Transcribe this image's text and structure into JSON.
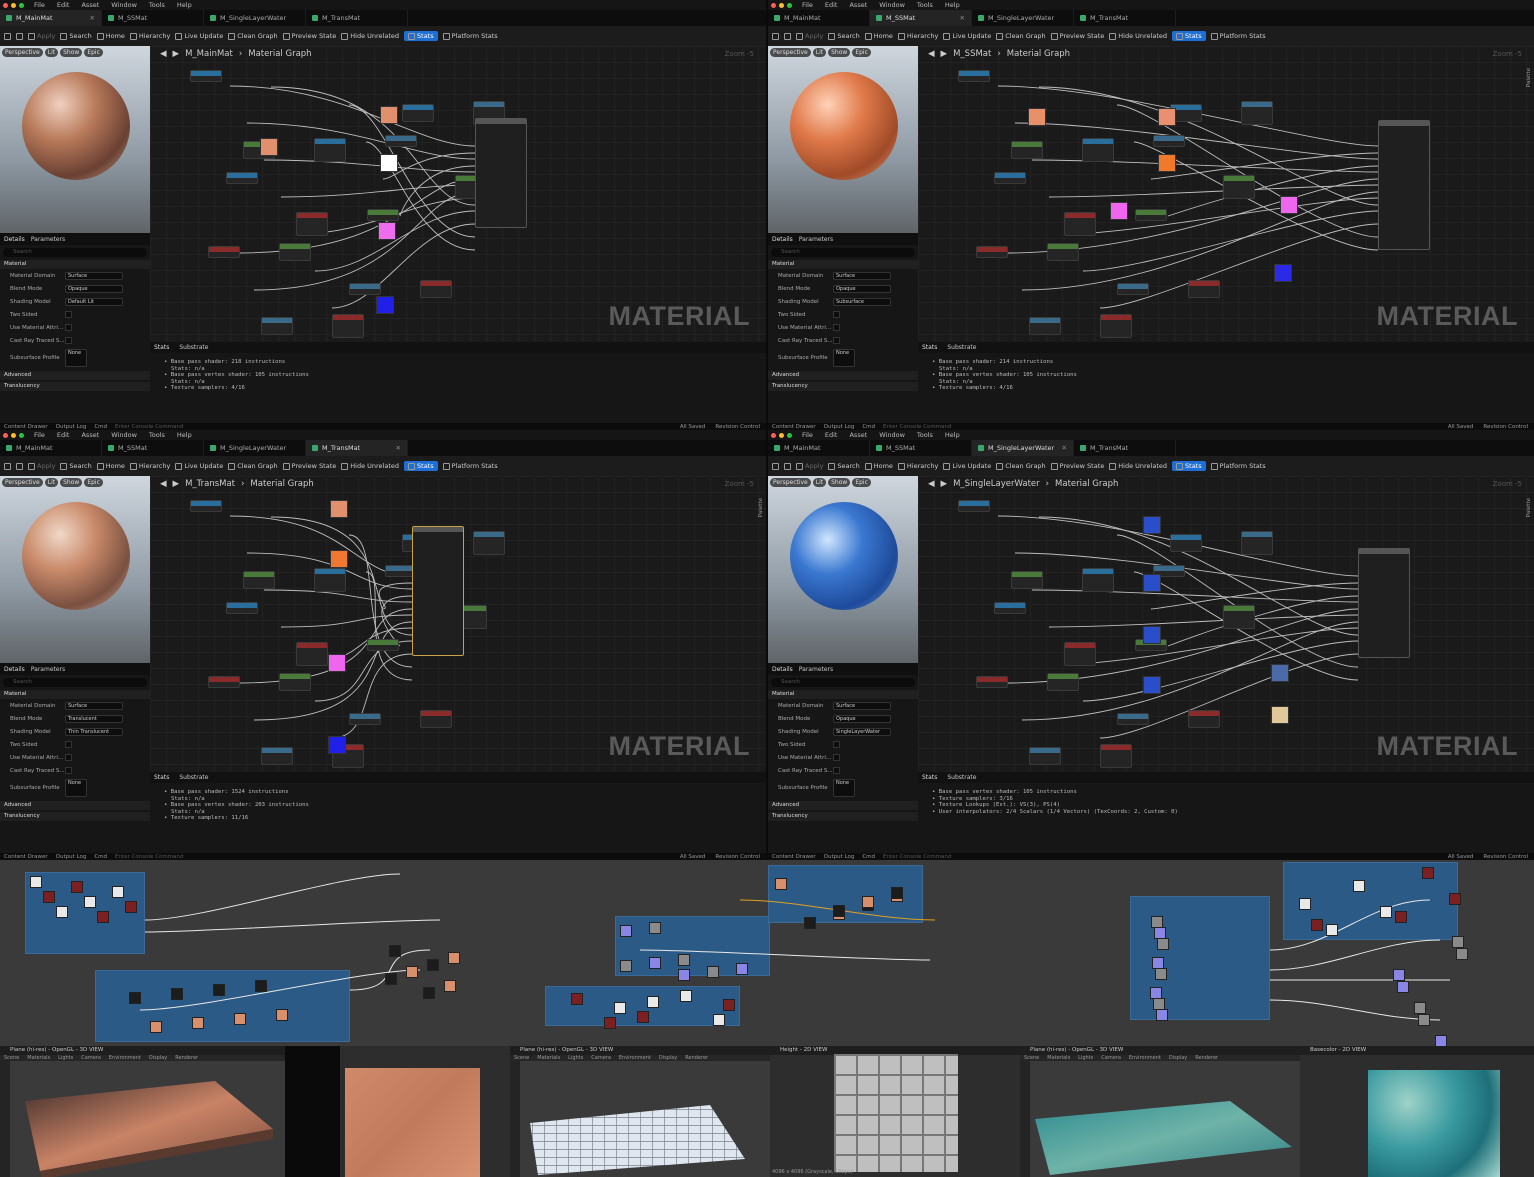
{
  "menu": [
    "File",
    "Edit",
    "Asset",
    "Window",
    "Tools",
    "Help"
  ],
  "tab_names": [
    "M_MainMat",
    "M_SSMat",
    "M_SingleLayerWater",
    "M_TransMat"
  ],
  "toolbar": {
    "apply": "Apply",
    "search": "Search",
    "home": "Home",
    "hierarchy": "Hierarchy",
    "live_update": "Live Update",
    "clean_graph": "Clean Graph",
    "preview_state": "Preview State",
    "hide_unrelated": "Hide Unrelated",
    "stats": "Stats",
    "platform_stats": "Platform Stats"
  },
  "viewport": {
    "perspective": "Perspective",
    "lit": "Lit",
    "show": "Show",
    "epic": "Epic"
  },
  "details": {
    "tab": "Details",
    "params": "Parameters",
    "search": "Search",
    "section": "Material",
    "domain_label": "Material Domain",
    "blend_label": "Blend Mode",
    "shading_label": "Shading Model",
    "two_sided": "Two Sided",
    "use_attr": "Use Material Attri...",
    "cast_ray": "Cast Ray Traced S...",
    "subsurface": "Subsurface Profile",
    "none": "None",
    "advanced": "Advanced",
    "translucency": "Translucency"
  },
  "graph": {
    "label": "Material Graph",
    "zoom": "Zoom -5",
    "watermark": "MATERIAL",
    "palette": "Palette"
  },
  "stats_tabs": {
    "stats": "Stats",
    "substrate": "Substrate"
  },
  "statusbar": {
    "content_drawer": "Content Drawer",
    "output_log": "Output Log",
    "cmd": "Cmd",
    "console": "Enter Console Command",
    "all_saved": "All Saved",
    "revision": "Revision Control"
  },
  "quads": [
    {
      "active_tab": 0,
      "title": "M_MainMat",
      "domain": "Surface",
      "blend": "Opaque",
      "shading": "Default Lit",
      "stats": [
        "Base pass shader: 218 instructions",
        "Stats: n/a",
        "Base pass vertex shader: 105 instructions",
        "Stats: n/a",
        "Texture samplers: 4/16"
      ]
    },
    {
      "active_tab": 1,
      "title": "M_SSMat",
      "domain": "Surface",
      "blend": "Opaque",
      "shading": "Subsurface",
      "stats": [
        "Base pass shader: 214 instructions",
        "Stats: n/a",
        "Base pass vertex shader: 105 instructions",
        "Stats: n/a",
        "Texture samplers: 4/16"
      ]
    },
    {
      "active_tab": 3,
      "title": "M_TransMat",
      "domain": "Surface",
      "blend": "Translucent",
      "shading": "Thin Translucent",
      "stats": [
        "Base pass shader: 1524 instructions",
        "Stats: n/a",
        "Base pass vertex shader: 203 instructions",
        "Stats: n/a",
        "Texture samplers: 11/16"
      ]
    },
    {
      "active_tab": 2,
      "title": "M_SingleLayerWater",
      "domain": "Surface",
      "blend": "Opaque",
      "shading": "SingleLayerWater",
      "stats": [
        "Base pass vertex shader: 105 instructions",
        "Texture samplers: 3/16",
        "Texture Lookups (Est.): VS(3), PS(4)",
        "User interpolators: 2/4 Scalars (1/4 Vectors) (TexCoords: 2, Custom: 0)"
      ]
    }
  ],
  "bottom_panels": [
    "Plane (hi-res) - OpenGL - 3D VIEW",
    "Basecolor - 2D VIEW",
    "Plane (hi-res) - OpenGL - 3D VIEW",
    "Height - 2D VIEW",
    "Plane (hi-res) - OpenGL - 3D VIEW",
    "Basecolor - 2D VIEW"
  ],
  "bottom_menu": [
    "Scene",
    "Materials",
    "Lights",
    "Camera",
    "Environment",
    "Display",
    "Renderer"
  ],
  "height_caption": "4096 x 4096 (Grayscale, 16bpc)",
  "colors": {
    "stats_blue": "#1d6fd6",
    "frame_blue": "#2c5a86",
    "selected": "#c9a14a"
  }
}
